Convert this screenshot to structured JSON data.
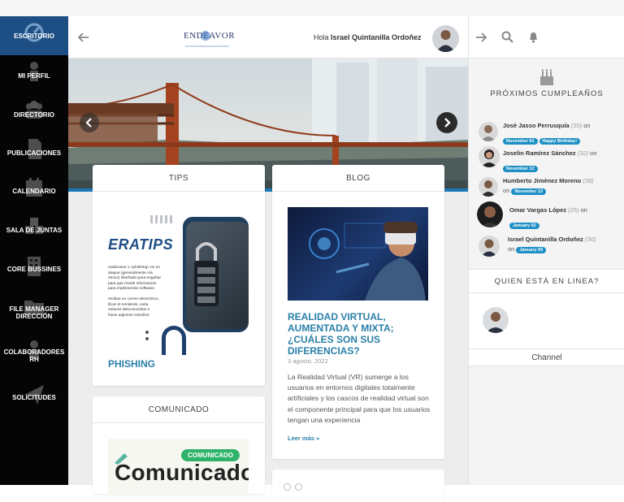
{
  "sidebar": {
    "items": [
      {
        "label": "ESCRITORIO",
        "icon": "dashboard-icon"
      },
      {
        "label": "MI PERFIL",
        "icon": "user-icon"
      },
      {
        "label": "DIRECTORIO",
        "icon": "users-icon"
      },
      {
        "label": "PUBLICACIONES",
        "icon": "document-icon"
      },
      {
        "label": "CALENDARIO",
        "icon": "calendar-icon"
      },
      {
        "label": "SALA DE JUNTAS",
        "icon": "cubes-icon"
      },
      {
        "label": "CORE BUSSINES",
        "icon": "building-icon"
      },
      {
        "label": "FILE MANAGER\nDIRECCIÓN",
        "icon": "folder-icon"
      },
      {
        "label": "COLABORADORES\nRH",
        "icon": "people-icon"
      },
      {
        "label": "SOLICITUDES",
        "icon": "send-icon"
      }
    ]
  },
  "header": {
    "logo_text": "ENDEAVOR",
    "greeting": "Hola",
    "user_name": "Israel Quintanilla Ordoñez"
  },
  "tips": {
    "title": "TIPS",
    "image_text": "ERATIPS",
    "image_body": "maliciosos o «phishing» es un\n ataque (generalmente vía\nómico) diseñado para engañar\n para que revele información\n para implementar software.\n\nrecibas un correo electrónico,\n ificar el remitente, evita\n enlaces desconocidos o\n hivos adjuntos extraños",
    "post_title": "PHISHING"
  },
  "blog": {
    "title": "BLOG",
    "post_title": "REALIDAD VIRTUAL, AUMENTADA Y MIXTA; ¿CUÁLES SON SUS DIFERENCIAS?",
    "date": "3 agosto, 2022",
    "excerpt": "La Realidad Virtual (VR) sumerge a los usuarios en entornos digitales totalmente artificiales y los cascos de realidad virtual son el componente principal para que los usuarios tengan una experiencia",
    "read_more": "Leer más »"
  },
  "comunicado": {
    "title": "COMUNICADO",
    "badge": "COMUNICADO",
    "image_text": "Comunicado"
  },
  "birthdays": {
    "title": "PRÓXIMOS CUMPLEAÑOS",
    "on_word": "on",
    "people": [
      {
        "name": "José Jasso Perrusquía",
        "age": "(30)",
        "date": "November 01",
        "extra": "Happy Birthday!"
      },
      {
        "name": "Joselin Ramírez Sánchez",
        "age": "(32)",
        "date": "November 12",
        "extra": ""
      },
      {
        "name": "Humberto Jiménez Moreno",
        "age": "(38)",
        "date": "November 13",
        "extra": ""
      },
      {
        "name": "Omar Vargas López",
        "age": "(25)",
        "date": "January 02",
        "extra": ""
      },
      {
        "name": "Israel Quintanilla Ordoñez",
        "age": "(36)",
        "date": "January 05",
        "extra": ""
      }
    ]
  },
  "online": {
    "title": "QUIEN ESTÁ EN LINEA?",
    "channel": "Channel"
  },
  "colors": {
    "sidebar_bg": "#050505",
    "sidebar_active": "#1d4f85",
    "accent": "#1e8fc5",
    "link_blue": "#2a7fa8"
  }
}
